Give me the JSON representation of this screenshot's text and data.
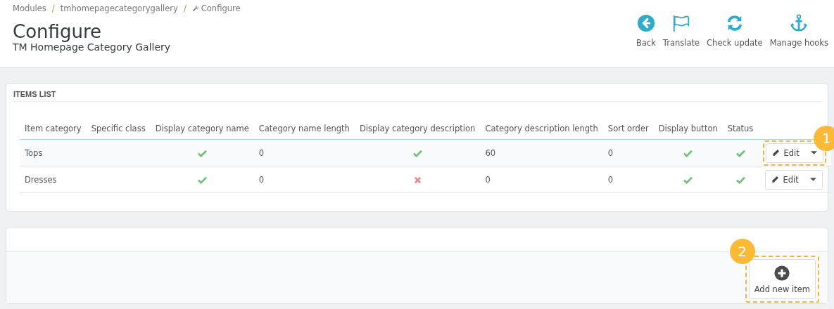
{
  "breadcrumb": [
    "Modules",
    "tmhomepagecategorygallery",
    "Configure"
  ],
  "breadcrumb_separator": "/",
  "title": "Configure",
  "subtitle": "TM Homepage Category Gallery",
  "toolbar": [
    {
      "kind": "back",
      "label": "Back"
    },
    {
      "kind": "translate",
      "label": "Translate"
    },
    {
      "kind": "update",
      "label": "Check update"
    },
    {
      "kind": "hooks",
      "label": "Manage hooks"
    }
  ],
  "items_panel": {
    "heading": "ITEMS LIST",
    "columns": [
      "Item category",
      "Specific class",
      "Display category name",
      "Category name length",
      "Display category description",
      "Category description length",
      "Sort order",
      "Display button",
      "Status"
    ],
    "rows": [
      {
        "highlighted": true,
        "category": "Tops",
        "display_name": true,
        "name_length": "0",
        "display_description": true,
        "description_length": "60",
        "sort_order": "0",
        "display_button": true,
        "status": true,
        "action": "Edit",
        "callout": "1"
      },
      {
        "highlighted": false,
        "category": "Dresses",
        "display_name": true,
        "name_length": "0",
        "display_description": false,
        "description_length": "0",
        "sort_order": "0",
        "display_button": true,
        "status": true,
        "action": "Edit"
      }
    ]
  },
  "add_panel": {
    "button": "Add new item",
    "callout": "2"
  }
}
